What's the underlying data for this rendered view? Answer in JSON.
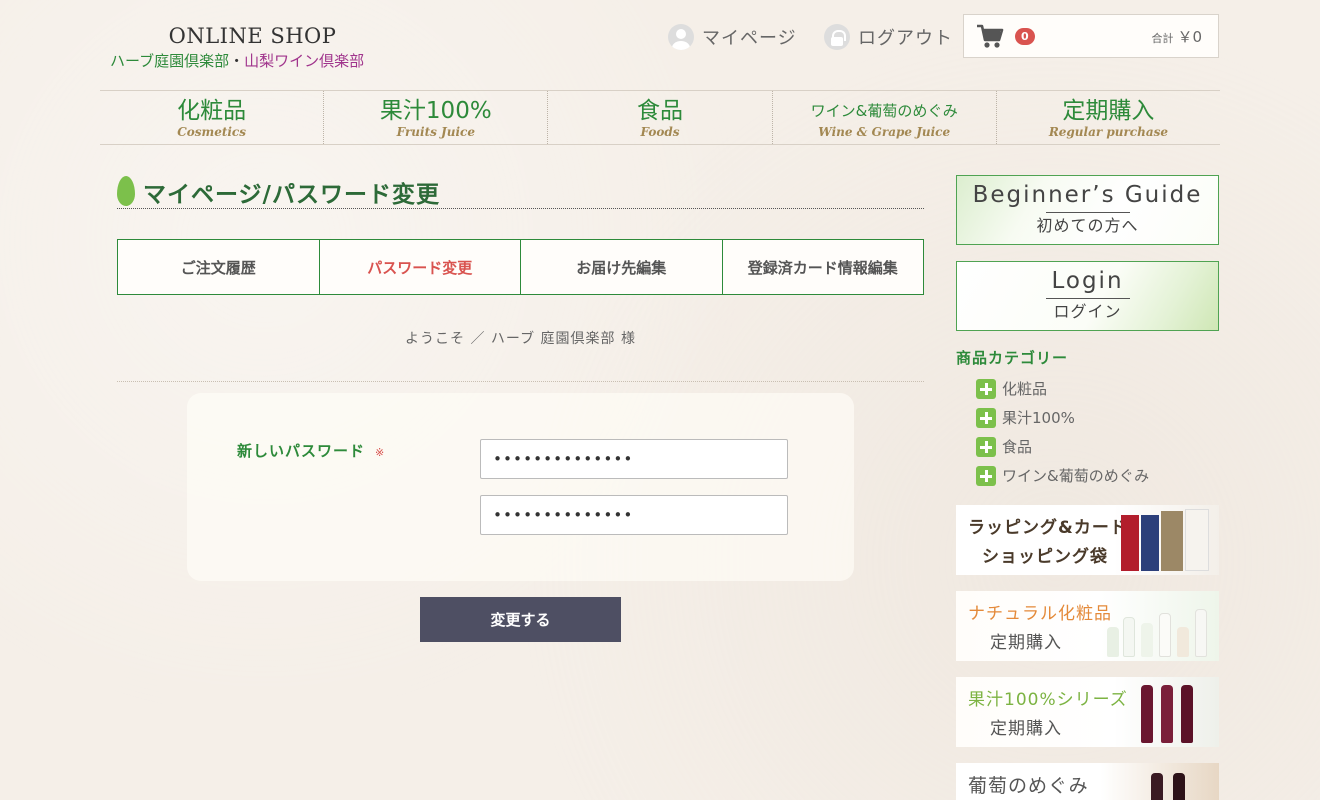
{
  "header": {
    "logo_title": "ONLINE SHOP",
    "logo_sub_green": "ハーブ庭園倶楽部",
    "logo_sub_dot": "・",
    "logo_sub_purple": "山梨ワイン倶楽部",
    "mypage_label": "マイページ",
    "logout_label": "ログアウト",
    "cart": {
      "count": "0",
      "total_prefix": "合計",
      "total_value": "￥0"
    }
  },
  "nav": [
    {
      "jp": "化粧品",
      "en": "Cosmetics"
    },
    {
      "jp": "果汁100%",
      "en": "Fruits Juice"
    },
    {
      "jp": "食品",
      "en": "Foods"
    },
    {
      "jp": "ワイン&葡萄のめぐみ",
      "en": "Wine & Grape Juice"
    },
    {
      "jp": "定期購入",
      "en": "Regular purchase"
    }
  ],
  "main": {
    "page_title": "マイページ/パスワード変更",
    "tabs": [
      {
        "label": "ご注文履歴"
      },
      {
        "label": "パスワード変更"
      },
      {
        "label": "お届け先編集"
      },
      {
        "label": "登録済カード情報編集"
      }
    ],
    "welcome": "ようこそ ／ ハーブ 庭園倶楽部 様",
    "form": {
      "label": "新しいパスワード",
      "required_mark": "※",
      "password_value": "••••••••••••••",
      "password_confirm_value": "••••••••••••••"
    },
    "submit_label": "変更する"
  },
  "sidebar": {
    "guide": {
      "en": "Beginner’s Guide",
      "jp": "初めての方へ"
    },
    "login": {
      "en": "Login",
      "jp": "ログイン"
    },
    "category_title": "商品カテゴリー",
    "categories": [
      "化粧品",
      "果汁100%",
      "食品",
      "ワイン&葡萄のめぐみ"
    ],
    "banners": {
      "wrapping_line1": "ラッピング&カード",
      "wrapping_line2": "ショッピング袋",
      "natural_line1": "ナチュラル化粧品",
      "natural_line2": "定期購入",
      "juice_line1": "果汁100%シリーズ",
      "juice_line2": "定期購入",
      "grape_line1": "葡萄のめぐみ"
    }
  },
  "colors": {
    "brand_green": "#2d8a3a",
    "accent_red": "#d9534f",
    "button_dark": "#4e4f63",
    "leaf_green": "#7cc04b"
  }
}
